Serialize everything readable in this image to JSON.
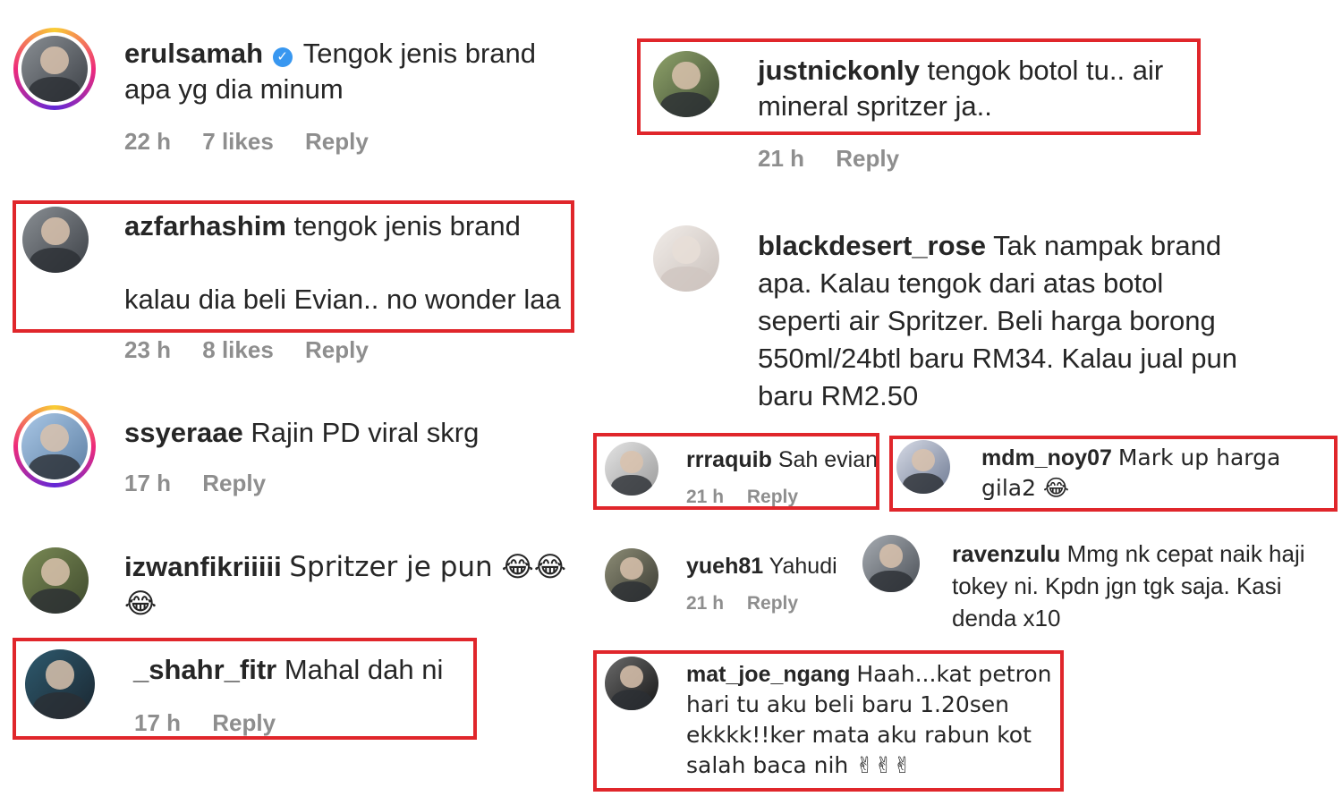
{
  "comments": [
    {
      "user": "erulsamah",
      "verified": true,
      "text": "Tengok jenis brand apa yg dia minum",
      "time": "22 h",
      "likes": "7 likes",
      "reply": "Reply"
    },
    {
      "user": "azfarhashim",
      "text_line1": "tengok jenis brand",
      "text_line2": "kalau dia beli Evian.. no wonder laa",
      "time": "23 h",
      "likes": "8 likes",
      "reply": "Reply"
    },
    {
      "user": "ssyeraae",
      "text": "Rajin PD viral skrg",
      "time": "17 h",
      "reply": "Reply"
    },
    {
      "user": "izwanfikriiiii",
      "text": "Spritzer je pun 😂😂😂",
      "reply": ""
    },
    {
      "user": "_shahr_fitr",
      "text": "Mahal dah ni",
      "time": "17 h",
      "reply": "Reply"
    },
    {
      "user": "justnickonly",
      "text": "tengok botol tu.. air mineral spritzer ja..",
      "time": "21 h",
      "reply": "Reply"
    },
    {
      "user": "blackdesert_rose",
      "text": "Tak nampak brand apa. Kalau tengok dari atas botol seperti air Spritzer. Beli harga borong 550ml/24btl baru RM34. Kalau jual pun baru RM2.50"
    },
    {
      "user": "rrraquib",
      "text": "Sah evian",
      "time": "21 h",
      "reply": "Reply"
    },
    {
      "user": "mdm_noy07",
      "text": "Mark up harga gila2 😂"
    },
    {
      "user": "yueh81",
      "text": "Yahudi",
      "time": "21 h",
      "reply": "Reply"
    },
    {
      "user": "ravenzulu",
      "text": "Mmg nk cepat naik haji tokey ni. Kpdn jgn tgk saja. Kasi denda x10"
    },
    {
      "user": "mat_joe_ngang",
      "text": "Haah...kat petron hari tu aku beli baru 1.20sen ekkkk!!ker mata aku rabun kot salah baca nih ✌✌✌"
    }
  ],
  "icons": {
    "verified": "verified-badge-icon"
  },
  "colors": {
    "highlight_border": "#e0262b",
    "meta_text": "#8e8e8e",
    "verified": "#3897f0"
  }
}
